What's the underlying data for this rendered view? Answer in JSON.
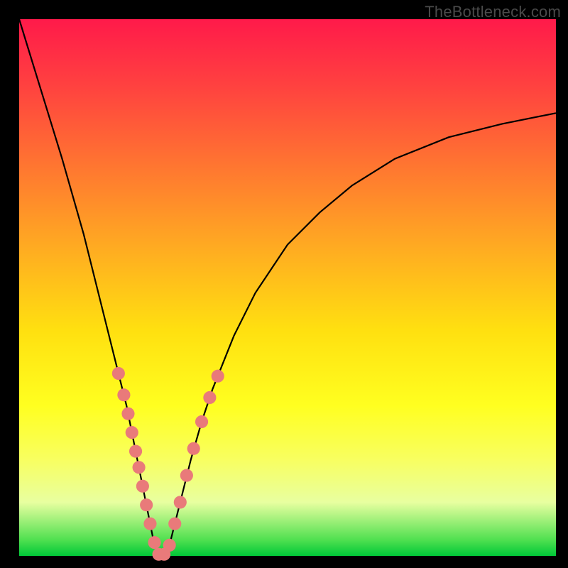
{
  "watermark": "TheBottleneck.com",
  "chart_data": {
    "type": "line",
    "title": "",
    "xlabel": "",
    "ylabel": "",
    "xlim": [
      0,
      100
    ],
    "ylim": [
      0,
      100
    ],
    "curve": {
      "x": [
        0,
        4,
        8,
        12,
        16,
        18,
        20,
        22,
        23,
        24,
        25,
        26,
        27,
        28,
        29,
        30,
        32,
        34,
        36,
        40,
        44,
        50,
        56,
        62,
        70,
        80,
        90,
        100
      ],
      "y": [
        100,
        87,
        74,
        60,
        44,
        36,
        28,
        18,
        13,
        8,
        3,
        0,
        0,
        2,
        6,
        10,
        18,
        25,
        31,
        41,
        49,
        58,
        64,
        69,
        74,
        78,
        80.5,
        82.5
      ]
    },
    "markers": {
      "color": "#e97a7a",
      "radius_frac": 0.012,
      "points": [
        {
          "x": 18.5,
          "y": 34
        },
        {
          "x": 19.5,
          "y": 30
        },
        {
          "x": 20.3,
          "y": 26.5
        },
        {
          "x": 21.0,
          "y": 23
        },
        {
          "x": 21.7,
          "y": 19.5
        },
        {
          "x": 22.3,
          "y": 16.5
        },
        {
          "x": 23.0,
          "y": 13
        },
        {
          "x": 23.7,
          "y": 9.5
        },
        {
          "x": 24.4,
          "y": 6
        },
        {
          "x": 25.2,
          "y": 2.5
        },
        {
          "x": 26.0,
          "y": 0.3
        },
        {
          "x": 27.0,
          "y": 0.3
        },
        {
          "x": 28.0,
          "y": 2
        },
        {
          "x": 29.0,
          "y": 6
        },
        {
          "x": 30.0,
          "y": 10
        },
        {
          "x": 31.2,
          "y": 15
        },
        {
          "x": 32.5,
          "y": 20
        },
        {
          "x": 34.0,
          "y": 25
        },
        {
          "x": 35.5,
          "y": 29.5
        },
        {
          "x": 37.0,
          "y": 33.5
        }
      ]
    }
  }
}
